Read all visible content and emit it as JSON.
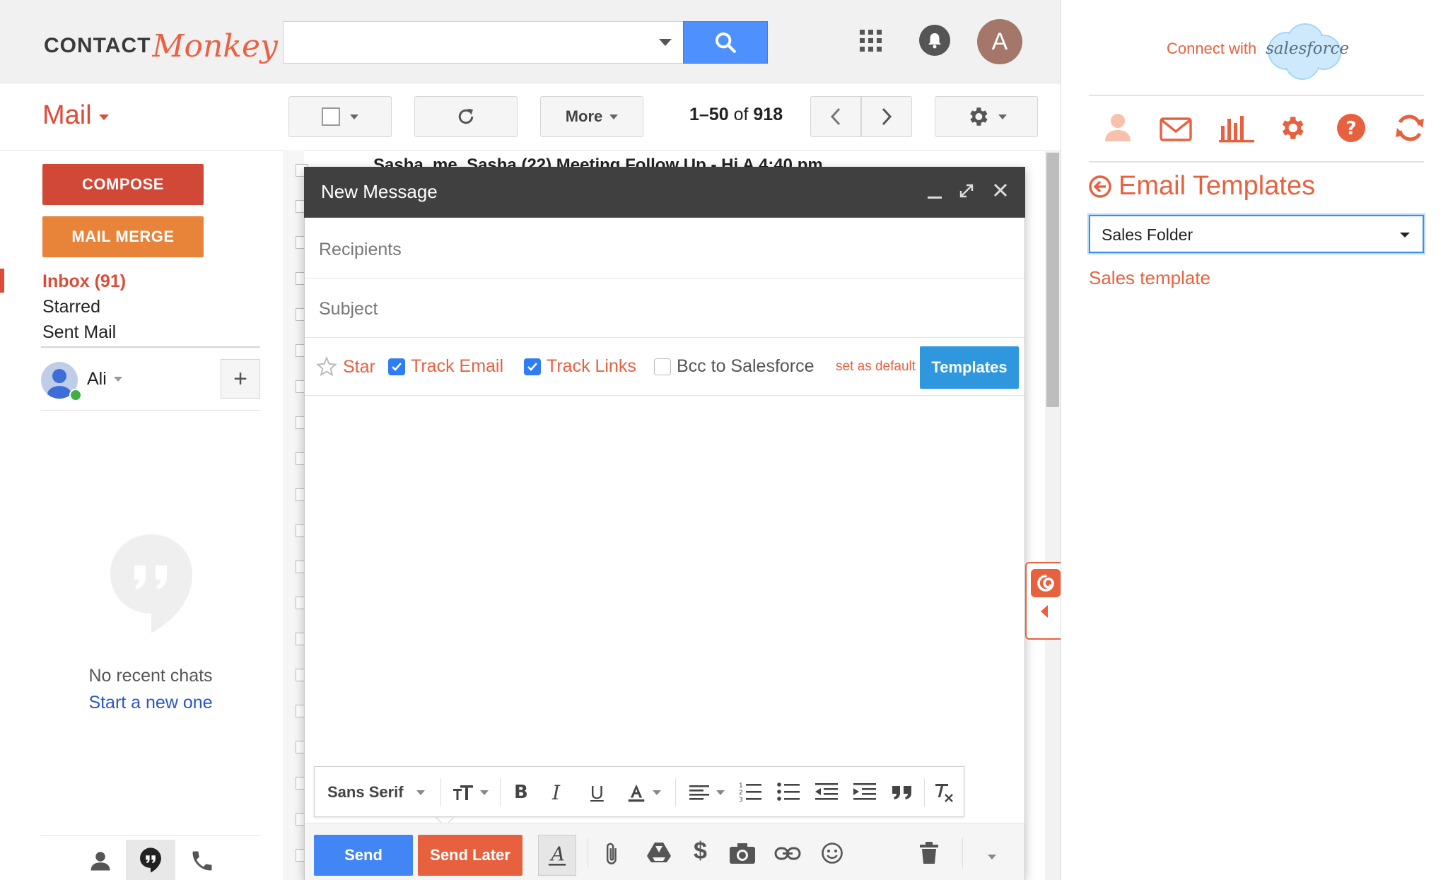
{
  "header": {
    "logo_part1": "CONTACT",
    "logo_part2": "Monkey",
    "search_placeholder": "",
    "avatar_letter": "A"
  },
  "toolbar": {
    "mail_label": "Mail",
    "more_label": "More",
    "pager_range": "1–50",
    "pager_of": "of",
    "pager_total": "918"
  },
  "sidebar": {
    "compose_label": "COMPOSE",
    "mail_merge_label": "MAIL MERGE",
    "nav": [
      {
        "label": "Inbox (91)"
      },
      {
        "label": "Starred"
      },
      {
        "label": "Sent Mail"
      }
    ],
    "user_name": "Ali",
    "add_label": "+",
    "no_chats": "No recent chats",
    "start_new": "Start a new one"
  },
  "list_peek": "Sasha, me, Sasha (22)    Meeting Follow Up  - Hi A    4:40 pm",
  "compose": {
    "title": "New Message",
    "recipients_placeholder": "Recipients",
    "subject_placeholder": "Subject",
    "star_label": "Star",
    "track_email_label": "Track Email",
    "track_email_checked": true,
    "track_links_label": "Track Links",
    "track_links_checked": true,
    "bcc_label": "Bcc to Salesforce",
    "bcc_checked": false,
    "set_default_label": "set as default",
    "templates_label": "Templates",
    "font_label": "Sans Serif",
    "send_label": "Send",
    "send_later_label": "Send Later"
  },
  "panel": {
    "connect_label": "Connect with",
    "salesforce_label": "salesforce",
    "title": "Email Templates",
    "folder_selected": "Sales Folder",
    "templates": [
      "Sales template"
    ]
  },
  "colors": {
    "gmail_red": "#dd4b39",
    "cm_orange": "#e8613f",
    "merge_orange": "#e8833a",
    "blue": "#4285f4",
    "templates_blue": "#2f97dd"
  }
}
